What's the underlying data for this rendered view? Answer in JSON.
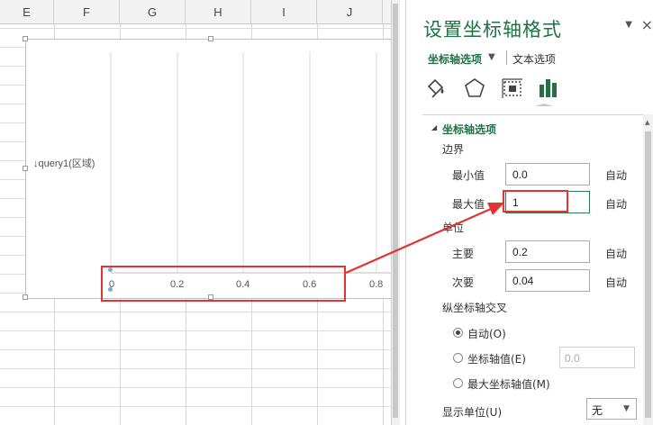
{
  "sheet": {
    "columns": [
      "E",
      "F",
      "G",
      "H",
      "I",
      "J"
    ]
  },
  "chart": {
    "series_label": "↓query1(区域)",
    "axis_ticks": [
      "0",
      "0.2",
      "0.4",
      "0.6",
      "0.8"
    ]
  },
  "pane": {
    "title": "设置坐标轴格式",
    "close": "×",
    "dropdown": "▼",
    "tabs": {
      "axis_options": "坐标轴选项",
      "text_options": "文本选项"
    },
    "icons": [
      "fill-line-icon",
      "effects-icon",
      "size-properties-icon",
      "axis-options-icon"
    ],
    "section_toggle": "◢",
    "section_title": "坐标轴选项",
    "bounds": {
      "label": "边界",
      "min_label": "最小值",
      "min_value": "0.0",
      "max_label": "最大值",
      "max_value": "1",
      "auto": "自动"
    },
    "units": {
      "label": "单位",
      "major_label": "主要",
      "major_value": "0.2",
      "minor_label": "次要",
      "minor_value": "0.04",
      "auto": "自动"
    },
    "cross": {
      "label": "纵坐标轴交叉",
      "options": [
        "自动(O)",
        "坐标轴值(E)",
        "最大坐标轴值(M)"
      ],
      "selected_index": 0,
      "axis_value": "0.0"
    },
    "display_unit": {
      "label": "显示单位(U)",
      "value": "无"
    }
  },
  "colors": {
    "accent": "#1f7244",
    "annotation": "#e53333",
    "chart_icon": "#217346"
  }
}
